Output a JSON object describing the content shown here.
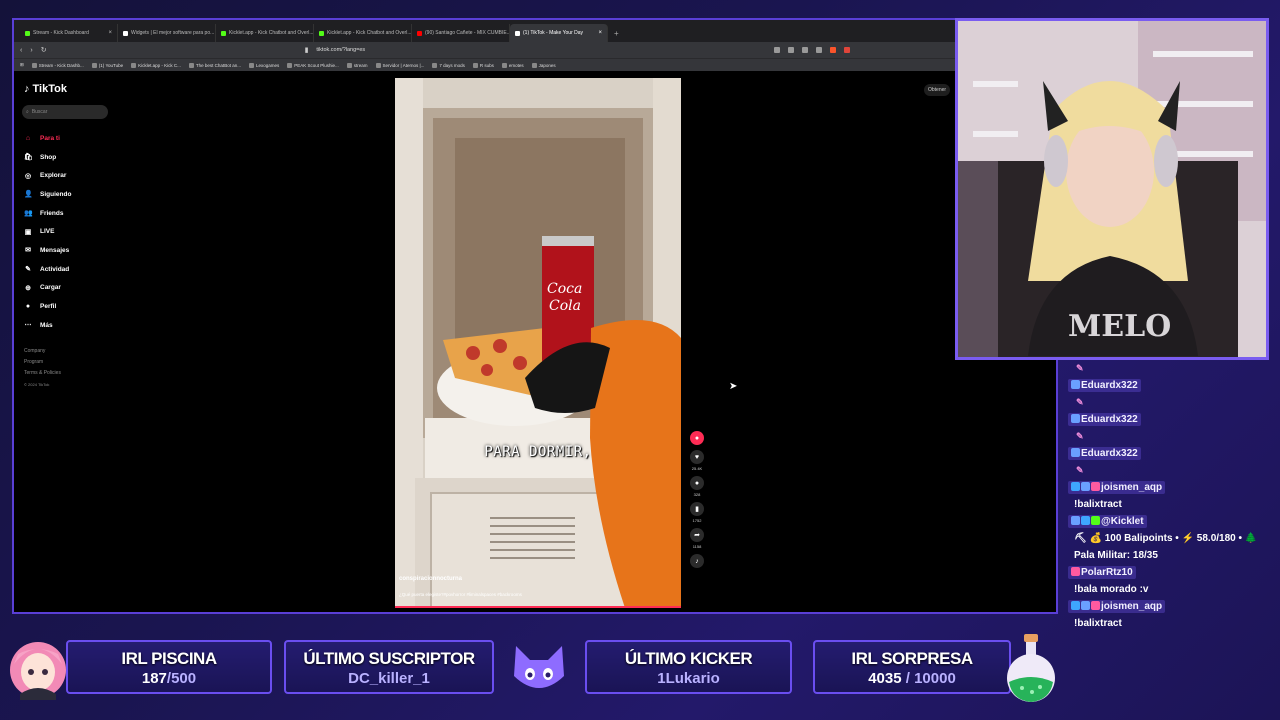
{
  "browser": {
    "tabs": [
      {
        "label": "Stream - Kick Dashboard",
        "color": "#53fc18",
        "active": false
      },
      {
        "label": "Widgets | El mejor software para po...",
        "color": "#ffffff",
        "active": false
      },
      {
        "label": "Kicklet.app - Kick Chatbot and Overl...",
        "color": "#53fc18",
        "active": false
      },
      {
        "label": "Kicklet.app - Kick Chatbot and Overl...",
        "color": "#53fc18",
        "active": false
      },
      {
        "label": "(90) Santiago Cañete - MIX CUMBIE...",
        "color": "#ff0000",
        "active": false
      },
      {
        "label": "(1) TikTok - Make Your Day",
        "color": "#ffffff",
        "active": true
      }
    ],
    "new_tab": "+",
    "url": "tiktok.com/?lang=es",
    "bookmarks": [
      "Stream - Kick Dashb...",
      "(1) YouTube",
      "Kicklet.app - Kick C...",
      "The best ChatBot an...",
      "Lexogames",
      "PEAK Scout Plushie...",
      "stream",
      "Servidor | Aternos |...",
      "7 days mods",
      "R subs",
      "emotes",
      "Japones"
    ]
  },
  "tiktok": {
    "logo": "TikTok",
    "search_placeholder": "Buscar",
    "nav": [
      {
        "label": "Para ti",
        "icon": "home-icon",
        "glyph": "⌂",
        "active": true
      },
      {
        "label": "Shop",
        "icon": "shop-icon",
        "glyph": "🛍",
        "active": false
      },
      {
        "label": "Explorar",
        "icon": "compass-icon",
        "glyph": "◎",
        "active": false
      },
      {
        "label": "Siguiendo",
        "icon": "following-icon",
        "glyph": "👤",
        "active": false
      },
      {
        "label": "Friends",
        "icon": "friends-icon",
        "glyph": "👥",
        "active": false
      },
      {
        "label": "LIVE",
        "icon": "live-icon",
        "glyph": "▣",
        "active": false
      },
      {
        "label": "Mensajes",
        "icon": "messages-icon",
        "glyph": "✉",
        "active": false
      },
      {
        "label": "Actividad",
        "icon": "activity-icon",
        "glyph": "✎",
        "active": false
      },
      {
        "label": "Cargar",
        "icon": "upload-icon",
        "glyph": "⊕",
        "active": false
      },
      {
        "label": "Perfil",
        "icon": "profile-icon",
        "glyph": "●",
        "active": false
      },
      {
        "label": "Más",
        "icon": "more-icon",
        "glyph": "⋯",
        "active": false
      }
    ],
    "footer": [
      "Company",
      "Program",
      "Terms & Policies",
      "© 2024 TikTok"
    ],
    "get_app": "Obtener",
    "video": {
      "caption": "PARA DORMIR,",
      "username": "conspiracionnocturna",
      "description": "¿Qué puerta elegiste?#povhorror #liminalspaces #backrooms"
    },
    "actions": [
      {
        "name": "like",
        "icon": "heart-icon",
        "glyph": "♥",
        "count": "25.4K"
      },
      {
        "name": "comment",
        "icon": "comment-icon",
        "glyph": "●",
        "count": "328"
      },
      {
        "name": "save",
        "icon": "bookmark-icon",
        "glyph": "▮",
        "count": "1752"
      },
      {
        "name": "share",
        "icon": "share-icon",
        "glyph": "➦",
        "count": "1158"
      }
    ]
  },
  "chat": [
    {
      "type": "emote"
    },
    {
      "type": "user",
      "user": "Eduardx322",
      "badges": [
        "#6aa0ff"
      ]
    },
    {
      "type": "emote"
    },
    {
      "type": "user",
      "user": "Eduardx322",
      "badges": [
        "#6aa0ff"
      ]
    },
    {
      "type": "emote"
    },
    {
      "type": "user",
      "user": "Eduardx322",
      "badges": [
        "#6aa0ff"
      ]
    },
    {
      "type": "emote"
    },
    {
      "type": "user",
      "user": "joismen_aqp",
      "badges": [
        "#3ea6ff",
        "#6aa0ff",
        "#ff5aa0"
      ]
    },
    {
      "type": "text",
      "text": "!balixtract"
    },
    {
      "type": "user",
      "user": "@Kicklet",
      "badges": [
        "#6aa0ff",
        "#3ea6ff",
        "#53fc18"
      ]
    },
    {
      "type": "text",
      "text": "⛏ 💰 100 Balipoints • ⚡ 58.0/180 • 🌲"
    },
    {
      "type": "text",
      "text": "Pala Militar: 18/35"
    },
    {
      "type": "user",
      "user": "PolarRtz10",
      "badges": [
        "#ff5aa0"
      ]
    },
    {
      "type": "text",
      "text": "!bala morado :v"
    },
    {
      "type": "user",
      "user": "joismen_aqp",
      "badges": [
        "#3ea6ff",
        "#6aa0ff",
        "#ff5aa0"
      ]
    },
    {
      "type": "text",
      "text": "!balixtract"
    }
  ],
  "overlay": {
    "cards": [
      {
        "title": "IRL PISCINA",
        "value_hl": "187",
        "value_rest": "/500"
      },
      {
        "title": "ÚLTIMO SUSCRIPTOR",
        "value_hl": "",
        "value_rest": "DC_killer_1"
      },
      {
        "title": "ÚLTIMO KICKER",
        "value_hl": "",
        "value_rest": "1Lukario"
      },
      {
        "title": "IRL SORPRESA",
        "value_hl": "4035",
        "value_rest": " / 10000"
      }
    ]
  },
  "colors": {
    "accent": "#6a4ef0",
    "tiktok_red": "#fe2c55",
    "kick_green": "#53fc18"
  }
}
